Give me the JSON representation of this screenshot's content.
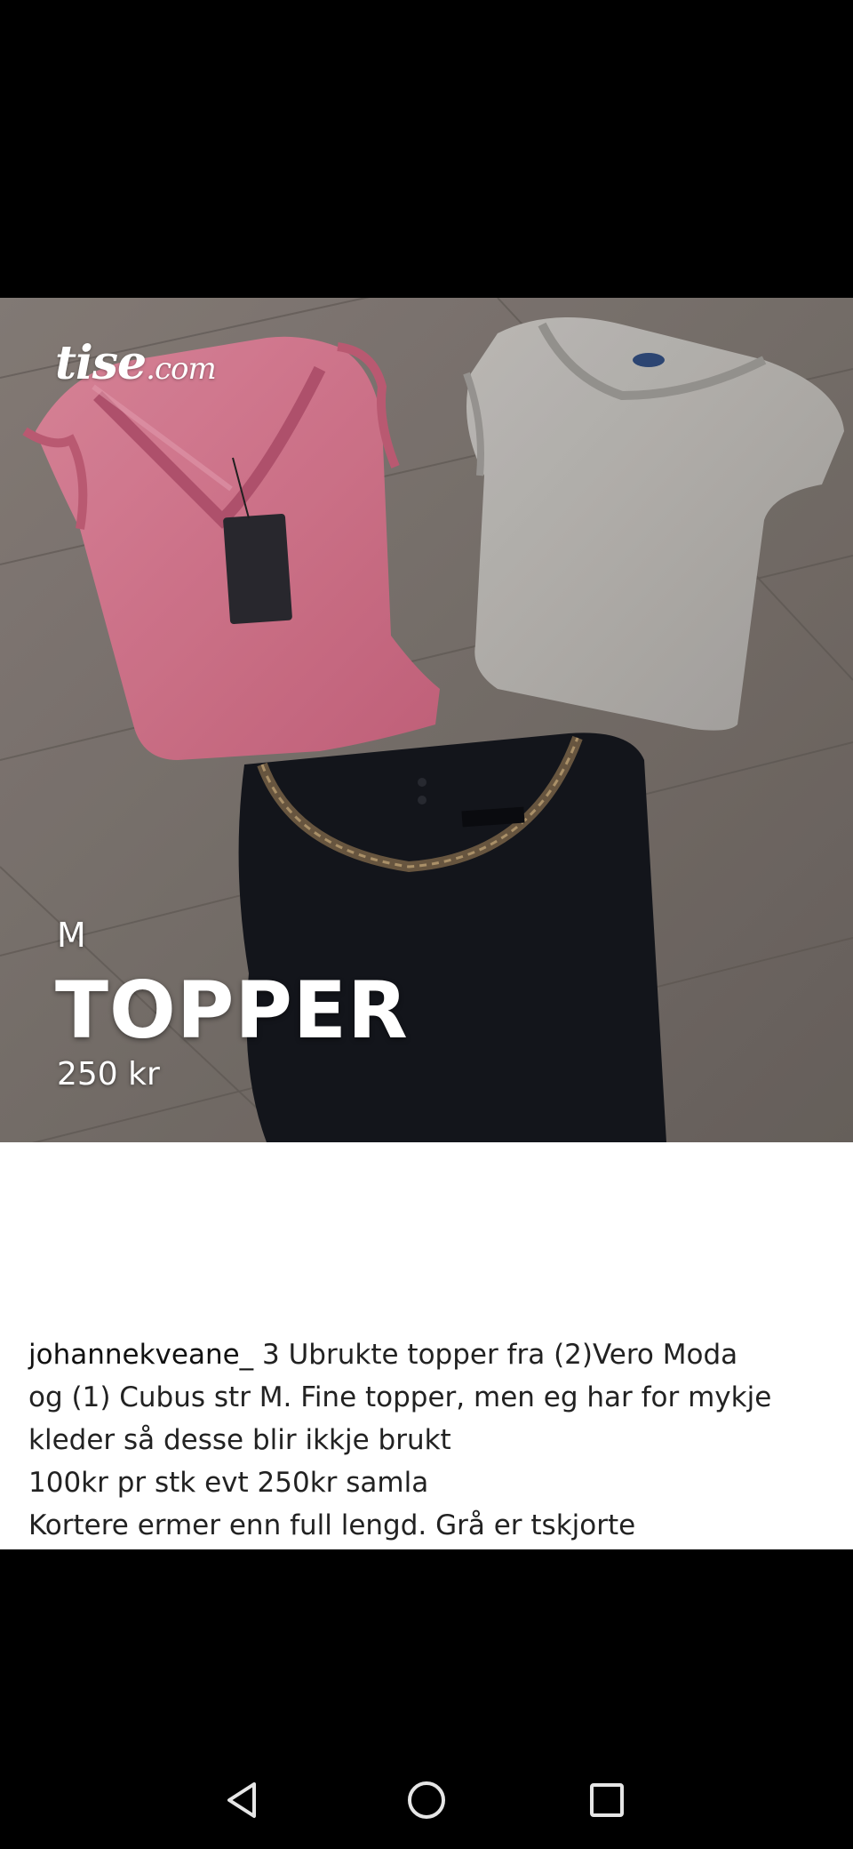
{
  "listing": {
    "watermark": "tise",
    "watermark_suffix": ".com",
    "size": "M",
    "title": "TOPPER",
    "price": "250 kr"
  },
  "caption": {
    "username": "johannekveane_",
    "lines": [
      " 3 Ubrukte topper fra (2)Vero Moda",
      "og (1) Cubus str M. Fine topper, men eg har for mykje",
      "kleder så desse blir ikkje brukt",
      "100kr pr stk evt 250kr samla",
      "Kortere ermer enn full lengd. Grå er tskjorte"
    ]
  },
  "navigation": {
    "back_icon": "back-triangle-icon",
    "home_icon": "home-circle-icon",
    "recents_icon": "recents-square-icon"
  },
  "colors": {
    "pink_top": "#d9778f",
    "grey_top": "#b9b6b2",
    "black_top": "#15171d",
    "floor": "#7d7570"
  }
}
